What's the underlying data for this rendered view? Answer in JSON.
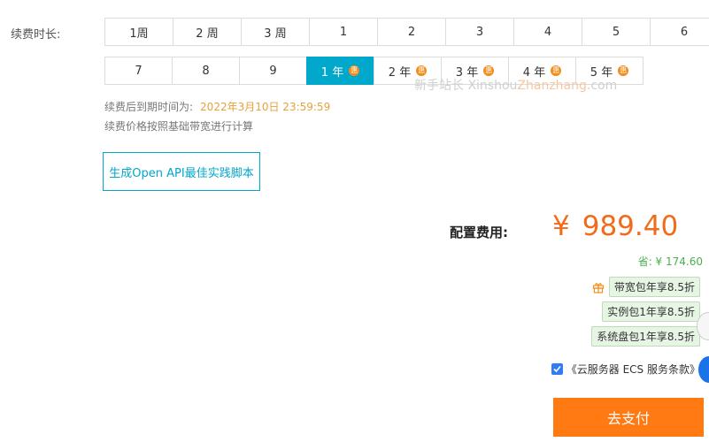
{
  "duration_label": "续费时长:",
  "row1": [
    "1周",
    "2 周",
    "3 周",
    "1",
    "2",
    "3",
    "4",
    "5",
    "6"
  ],
  "row2": [
    {
      "label": "7",
      "badge": false
    },
    {
      "label": "8",
      "badge": false
    },
    {
      "label": "9",
      "badge": false
    },
    {
      "label": "1 年",
      "badge": true,
      "selected": true
    },
    {
      "label": "2 年",
      "badge": true
    },
    {
      "label": "3 年",
      "badge": true
    },
    {
      "label": "4 年",
      "badge": true
    },
    {
      "label": "5 年",
      "badge": true
    }
  ],
  "badge_char": "惠",
  "watermark": {
    "a": "新手站长 Xinshou",
    "b": "Zhanzhang",
    "c": ".com"
  },
  "expire_label": "续费后到期时间为:",
  "expire_value": "2022年3月10日 23:59:59",
  "note": "续费价格按照基础带宽进行计算",
  "api_button": "生成Open API最佳实践脚本",
  "cost_label": "配置费用:",
  "currency": "¥",
  "cost_amount": "989.40",
  "saving": "省: ¥ 174.60",
  "promos": [
    "带宽包年享8.5折",
    "实例包1年享8.5折",
    "系统盘包1年享8.5折"
  ],
  "terms": "《云服务器 ECS 服务条款》",
  "pay_button": "去支付",
  "colors": {
    "accent": "#00a8cc",
    "price": "#f06c1a",
    "pay": "#ff7a12",
    "saving": "#4caf50"
  }
}
